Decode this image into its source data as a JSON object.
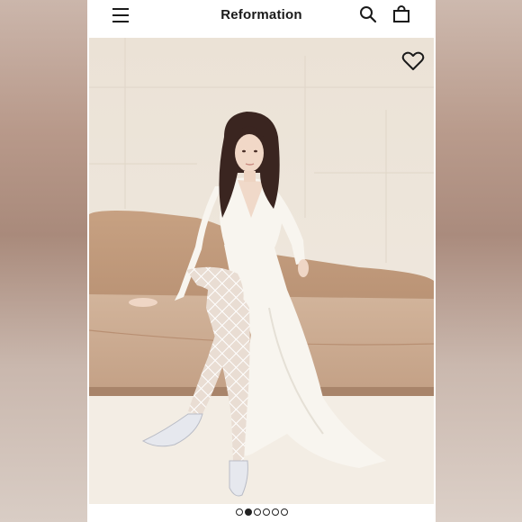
{
  "header": {
    "brand": "Reformation",
    "icons": [
      "menu-icon",
      "search-icon",
      "shopping-bag-icon"
    ]
  },
  "gallery": {
    "wishlist_icon": "heart-outline-icon",
    "slide_count": 6,
    "active_slide": 2
  },
  "colors": {
    "text": "#1a1a1a",
    "backdrop": "#efe7dd",
    "sofa": "#c9a58a",
    "dress": "#f8f5ef"
  }
}
